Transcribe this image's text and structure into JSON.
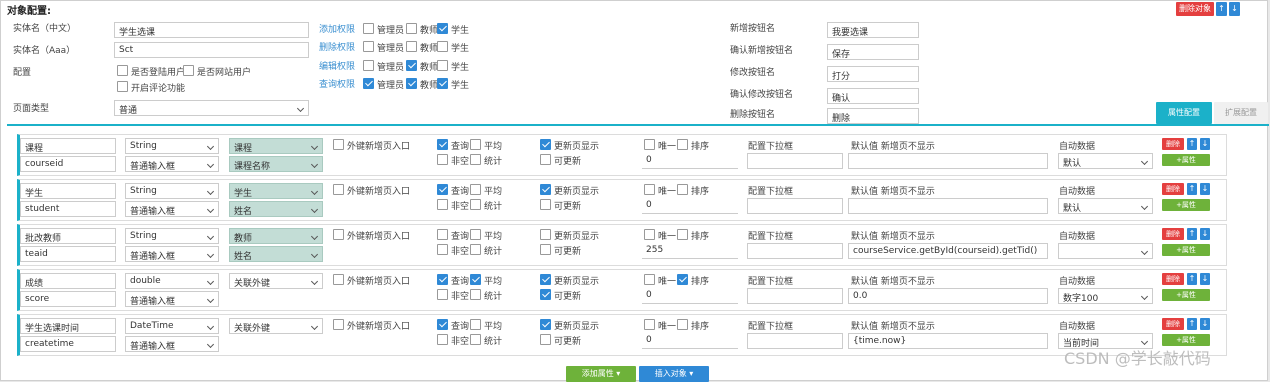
{
  "header": {
    "title": "对象配置:",
    "delete_label": "删除对象",
    "up_label": "↑",
    "down_label": "↓"
  },
  "form": {
    "cn_name_label": "实体名（中文）",
    "cn_name_value": "学生选课",
    "en_name_label": "实体名（Aaa）",
    "en_name_value": "Sct",
    "config_label": "配置",
    "opts": [
      "是否登陆用户",
      "是否网站用户",
      "开启评论功能"
    ],
    "page_type_label": "页面类型",
    "page_type_value": "普通"
  },
  "perms": [
    {
      "label": "添加权限",
      "checks": [
        {
          "t": "管理员",
          "on": false
        },
        {
          "t": "教师",
          "on": false
        },
        {
          "t": "学生",
          "on": true
        }
      ]
    },
    {
      "label": "删除权限",
      "checks": [
        {
          "t": "管理员",
          "on": false
        },
        {
          "t": "教师",
          "on": false
        },
        {
          "t": "学生",
          "on": false
        }
      ]
    },
    {
      "label": "编辑权限",
      "checks": [
        {
          "t": "管理员",
          "on": false
        },
        {
          "t": "教师",
          "on": true
        },
        {
          "t": "学生",
          "on": false
        }
      ]
    },
    {
      "label": "查询权限",
      "checks": [
        {
          "t": "管理员",
          "on": true
        },
        {
          "t": "教师",
          "on": true
        },
        {
          "t": "学生",
          "on": true
        }
      ]
    }
  ],
  "buttons_config": [
    {
      "label": "新增按钮名",
      "value": "我要选课"
    },
    {
      "label": "确认新增按钮名",
      "value": "保存"
    },
    {
      "label": "修改按钮名",
      "value": "打分"
    },
    {
      "label": "确认修改按钮名",
      "value": "确认"
    },
    {
      "label": "删除按钮名",
      "value": "删除"
    }
  ],
  "tabs": [
    "属性配置",
    "扩展配置"
  ],
  "col_labels": {
    "fk": "外键新增页入口",
    "query": "查询",
    "avg": "平均",
    "nonempty": "非空",
    "stat": "统计",
    "showupd": "更新页显示",
    "editable": "可更新",
    "unique": "唯一",
    "sort": "排序",
    "dropdown": "配置下拉框",
    "default": "默认值 新增页不显示",
    "auto": "自动数据",
    "del": "删除",
    "addattr": "+属性"
  },
  "rows": [
    {
      "name": "课程",
      "field": "courseid",
      "type": "String",
      "input": "普通输入框",
      "ref1": "课程",
      "ref2": "课程名称",
      "ref_teal": true,
      "fk": false,
      "query": true,
      "avg": false,
      "nonempty": false,
      "stat": false,
      "showupd": true,
      "editable": false,
      "unique": false,
      "sort": false,
      "num": "0",
      "dropdown": "",
      "default": "",
      "auto": "默认"
    },
    {
      "name": "学生",
      "field": "student",
      "type": "String",
      "input": "普通输入框",
      "ref1": "学生",
      "ref2": "姓名",
      "ref_teal": true,
      "fk": false,
      "query": true,
      "avg": false,
      "nonempty": false,
      "stat": false,
      "showupd": true,
      "editable": false,
      "unique": false,
      "sort": false,
      "num": "0",
      "dropdown": "",
      "default": "",
      "auto": "默认"
    },
    {
      "name": "批改教师",
      "field": "teaid",
      "type": "String",
      "input": "普通输入框",
      "ref1": "教师",
      "ref2": "姓名",
      "ref_teal": true,
      "fk": false,
      "query": false,
      "avg": false,
      "nonempty": false,
      "stat": false,
      "showupd": false,
      "editable": false,
      "unique": false,
      "sort": false,
      "num": "255",
      "dropdown": "",
      "default": "courseService.getById(courseid).getTid()",
      "auto": ""
    },
    {
      "name": "成绩",
      "field": "score",
      "type": "double",
      "input": "普通输入框",
      "ref1": "关联外键",
      "ref2": "",
      "ref_teal": false,
      "fk": false,
      "query": true,
      "avg": true,
      "nonempty": false,
      "stat": false,
      "showupd": true,
      "editable": true,
      "unique": false,
      "sort": true,
      "num": "0",
      "dropdown": "",
      "default": "0.0",
      "auto": "数字100"
    },
    {
      "name": "学生选课时间",
      "field": "createtime",
      "type": "DateTime",
      "input": "普通输入框",
      "ref1": "关联外键",
      "ref2": "",
      "ref_teal": false,
      "fk": false,
      "query": true,
      "avg": false,
      "nonempty": false,
      "stat": false,
      "showupd": true,
      "editable": false,
      "unique": false,
      "sort": false,
      "num": "0",
      "dropdown": "",
      "default": "{time.now}",
      "auto": "当前时间"
    }
  ],
  "footer": {
    "add_attr": "添加属性",
    "insert_obj": "插入对象",
    "watermark": "CSDN @学长敲代码"
  }
}
